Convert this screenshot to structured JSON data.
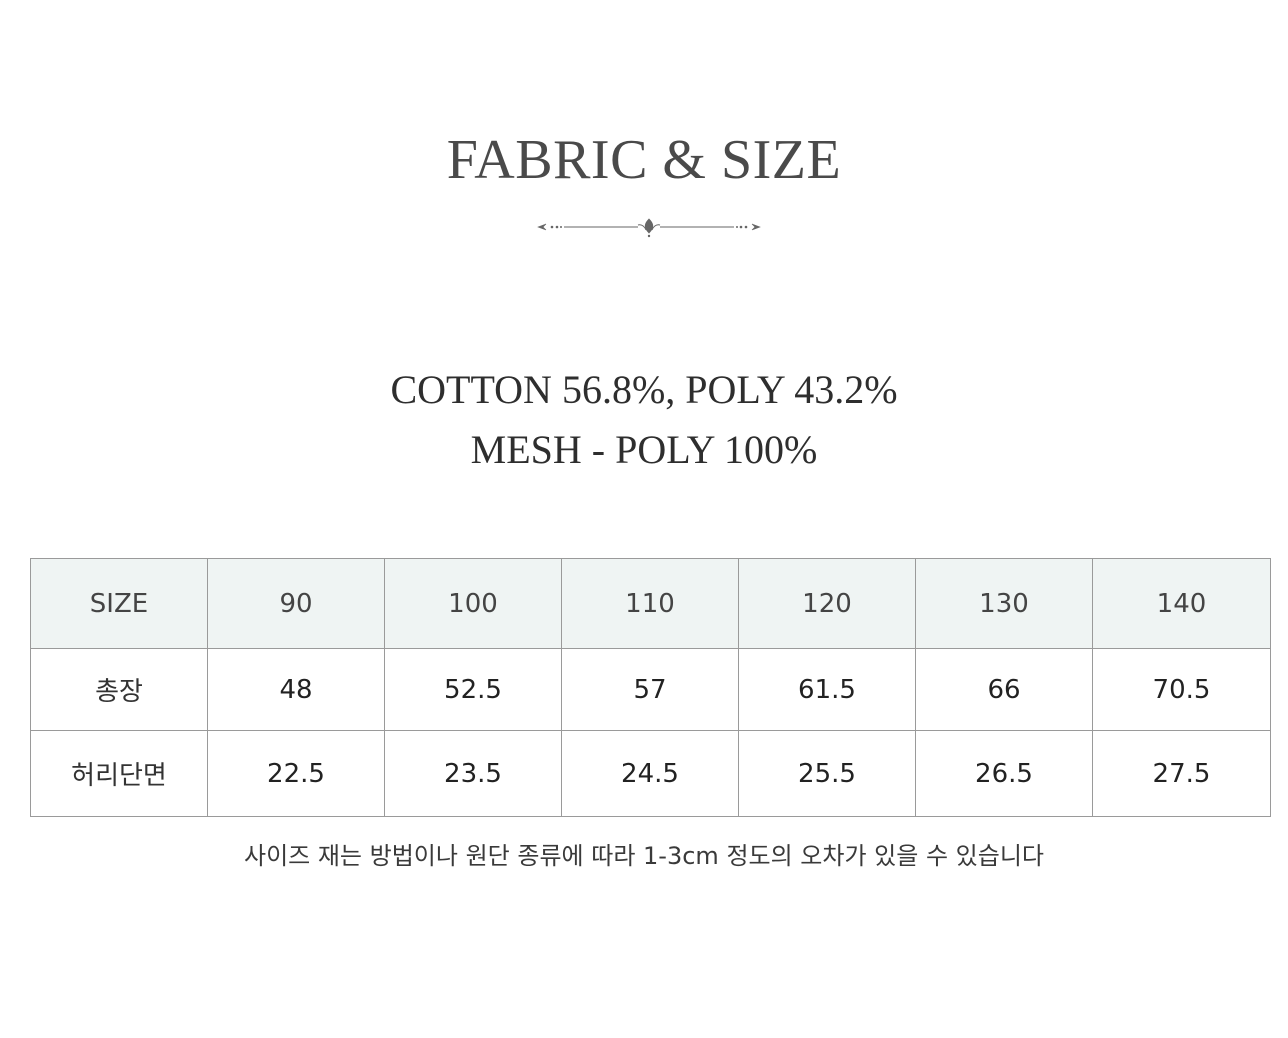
{
  "title": "FABRIC & SIZE",
  "fabric": {
    "line1": "COTTON 56.8%, POLY 43.2%",
    "line2": "MESH - POLY 100%"
  },
  "table": {
    "header": [
      "SIZE",
      "90",
      "100",
      "110",
      "120",
      "130",
      "140"
    ],
    "rows": [
      [
        "총장",
        "48",
        "52.5",
        "57",
        "61.5",
        "66",
        "70.5"
      ],
      [
        "허리단면",
        "22.5",
        "23.5",
        "24.5",
        "25.5",
        "26.5",
        "27.5"
      ]
    ]
  },
  "note": "사이즈 재는 방법이나 원단 종류에 따라 1-3cm 정도의 오차가 있을 수 있습니다",
  "colors": {
    "header_bg": "#eff4f3",
    "border": "#9a9a9a",
    "title": "#4a4a4a"
  }
}
